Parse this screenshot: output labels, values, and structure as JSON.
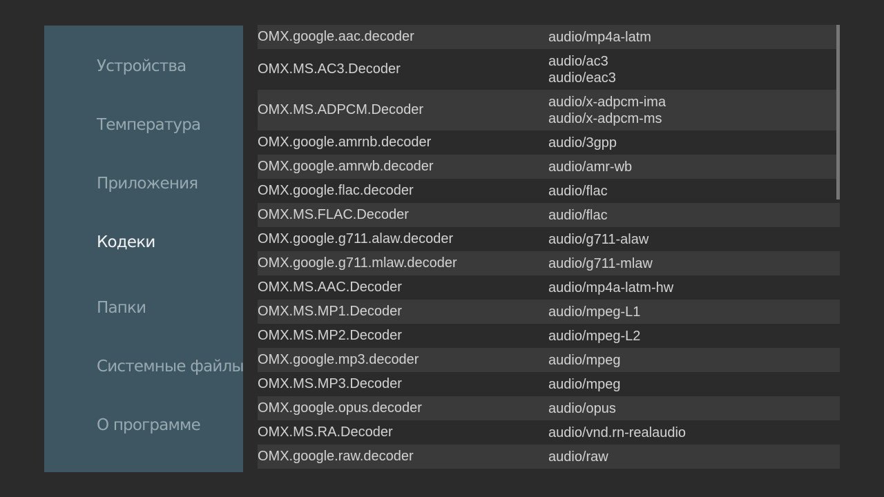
{
  "sidebar": {
    "items": [
      {
        "label": "Устройства",
        "active": false
      },
      {
        "label": "Температура",
        "active": false
      },
      {
        "label": "Приложения",
        "active": false
      },
      {
        "label": "Кодеки",
        "active": true
      },
      {
        "label": "Папки",
        "active": false
      },
      {
        "label": "Системные файлы",
        "active": false
      },
      {
        "label": "О программе",
        "active": false
      }
    ]
  },
  "codecs": [
    {
      "name": "OMX.google.aac.decoder",
      "types": [
        "audio/mp4a-latm"
      ]
    },
    {
      "name": "OMX.MS.AC3.Decoder",
      "types": [
        "audio/ac3",
        "audio/eac3"
      ]
    },
    {
      "name": "OMX.MS.ADPCM.Decoder",
      "types": [
        "audio/x-adpcm-ima",
        "audio/x-adpcm-ms"
      ]
    },
    {
      "name": "OMX.google.amrnb.decoder",
      "types": [
        "audio/3gpp"
      ]
    },
    {
      "name": "OMX.google.amrwb.decoder",
      "types": [
        "audio/amr-wb"
      ]
    },
    {
      "name": "OMX.google.flac.decoder",
      "types": [
        "audio/flac"
      ]
    },
    {
      "name": "OMX.MS.FLAC.Decoder",
      "types": [
        "audio/flac"
      ]
    },
    {
      "name": "OMX.google.g711.alaw.decoder",
      "types": [
        "audio/g711-alaw"
      ]
    },
    {
      "name": "OMX.google.g711.mlaw.decoder",
      "types": [
        "audio/g711-mlaw"
      ]
    },
    {
      "name": "OMX.MS.AAC.Decoder",
      "types": [
        "audio/mp4a-latm-hw"
      ]
    },
    {
      "name": "OMX.MS.MP1.Decoder",
      "types": [
        "audio/mpeg-L1"
      ]
    },
    {
      "name": "OMX.MS.MP2.Decoder",
      "types": [
        "audio/mpeg-L2"
      ]
    },
    {
      "name": "OMX.google.mp3.decoder",
      "types": [
        "audio/mpeg"
      ]
    },
    {
      "name": "OMX.MS.MP3.Decoder",
      "types": [
        "audio/mpeg"
      ]
    },
    {
      "name": "OMX.google.opus.decoder",
      "types": [
        "audio/opus"
      ]
    },
    {
      "name": "OMX.MS.RA.Decoder",
      "types": [
        "audio/vnd.rn-realaudio"
      ]
    },
    {
      "name": "OMX.google.raw.decoder",
      "types": [
        "audio/raw"
      ]
    },
    {
      "name": "",
      "types": []
    }
  ],
  "colors": {
    "background": "#2b2b2b",
    "sidebar": "#3e5661",
    "nav_text": "#96a9b1",
    "nav_active": "#f2f4f5",
    "row_alt": "#3a3a3a",
    "list_text": "#d3d3d3",
    "scrollbar": "#767676"
  }
}
